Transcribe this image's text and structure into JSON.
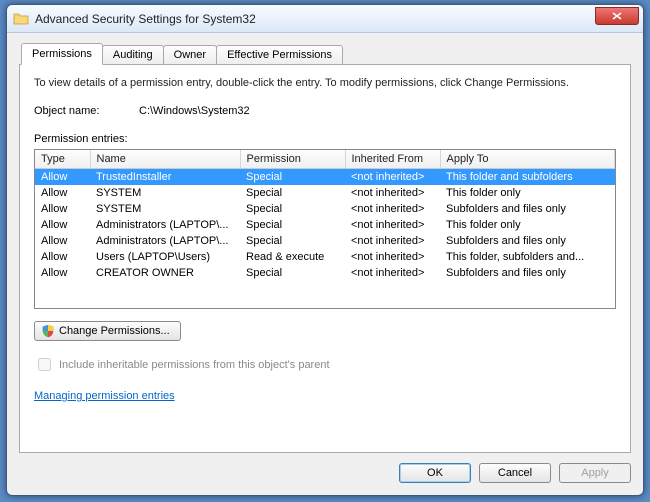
{
  "window": {
    "title": "Advanced Security Settings for System32"
  },
  "tabs": {
    "permissions": "Permissions",
    "auditing": "Auditing",
    "owner": "Owner",
    "effective": "Effective Permissions"
  },
  "instruction": "To view details of a permission entry, double-click the entry. To modify permissions, click Change Permissions.",
  "object_name_label": "Object name:",
  "object_name_value": "C:\\Windows\\System32",
  "permission_entries_label": "Permission entries:",
  "columns": {
    "type": "Type",
    "name": "Name",
    "permission": "Permission",
    "inherited_from": "Inherited From",
    "apply_to": "Apply To"
  },
  "entries": [
    {
      "type": "Allow",
      "name": "TrustedInstaller",
      "permission": "Special",
      "inherited": "<not inherited>",
      "apply_to": "This folder and subfolders",
      "selected": true
    },
    {
      "type": "Allow",
      "name": "SYSTEM",
      "permission": "Special",
      "inherited": "<not inherited>",
      "apply_to": "This folder only"
    },
    {
      "type": "Allow",
      "name": "SYSTEM",
      "permission": "Special",
      "inherited": "<not inherited>",
      "apply_to": "Subfolders and files only"
    },
    {
      "type": "Allow",
      "name": "Administrators (LAPTOP\\...",
      "permission": "Special",
      "inherited": "<not inherited>",
      "apply_to": "This folder only"
    },
    {
      "type": "Allow",
      "name": "Administrators (LAPTOP\\...",
      "permission": "Special",
      "inherited": "<not inherited>",
      "apply_to": "Subfolders and files only"
    },
    {
      "type": "Allow",
      "name": "Users (LAPTOP\\Users)",
      "permission": "Read & execute",
      "inherited": "<not inherited>",
      "apply_to": "This folder, subfolders and..."
    },
    {
      "type": "Allow",
      "name": "CREATOR OWNER",
      "permission": "Special",
      "inherited": "<not inherited>",
      "apply_to": "Subfolders and files only"
    }
  ],
  "change_permissions_label": "Change Permissions...",
  "include_inheritable_label": "Include inheritable permissions from this object's parent",
  "manage_link": "Managing permission entries",
  "buttons": {
    "ok": "OK",
    "cancel": "Cancel",
    "apply": "Apply"
  }
}
